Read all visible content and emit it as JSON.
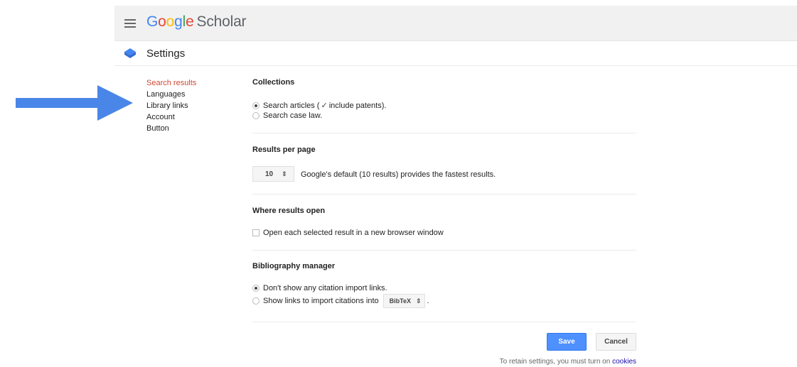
{
  "header": {
    "logo_letters": [
      "G",
      "o",
      "o",
      "g",
      "l",
      "e"
    ],
    "product": "Scholar"
  },
  "settings": {
    "title": "Settings"
  },
  "sidebar": {
    "items": [
      {
        "label": "Search results",
        "active": true
      },
      {
        "label": "Languages",
        "active": false
      },
      {
        "label": "Library links",
        "active": false
      },
      {
        "label": "Account",
        "active": false
      },
      {
        "label": "Button",
        "active": false
      }
    ]
  },
  "collections": {
    "title": "Collections",
    "opt1_prefix": "Search articles (",
    "opt1_check": "✓",
    "opt1_suffix": " include patents).",
    "opt1_checked": true,
    "opt2": "Search case law.",
    "opt2_checked": false
  },
  "results_per_page": {
    "title": "Results per page",
    "value": "10",
    "arrows": "⇕",
    "hint": "Google's default (10 results) provides the fastest results."
  },
  "where_open": {
    "title": "Where results open",
    "checkbox_label": "Open each selected result in a new browser window",
    "checked": false
  },
  "bibliography": {
    "title": "Bibliography manager",
    "opt1": "Don't show any citation import links.",
    "opt1_checked": true,
    "opt2": "Show links to import citations into",
    "opt2_checked": false,
    "format": "BibTeX",
    "arrows": "⇕",
    "trailing": "."
  },
  "buttons": {
    "save": "Save",
    "cancel": "Cancel"
  },
  "footer": {
    "retain_prefix": "To retain settings, you must turn on ",
    "retain_link": "cookies"
  },
  "colors": {
    "accent": "#4d90fe",
    "active_nav": "#d14836",
    "arrow": "#4a86e8"
  },
  "icons": {
    "menu": "hamburger-icon",
    "settings": "settings-diamond-icon",
    "annotation": "arrow-right-icon"
  }
}
